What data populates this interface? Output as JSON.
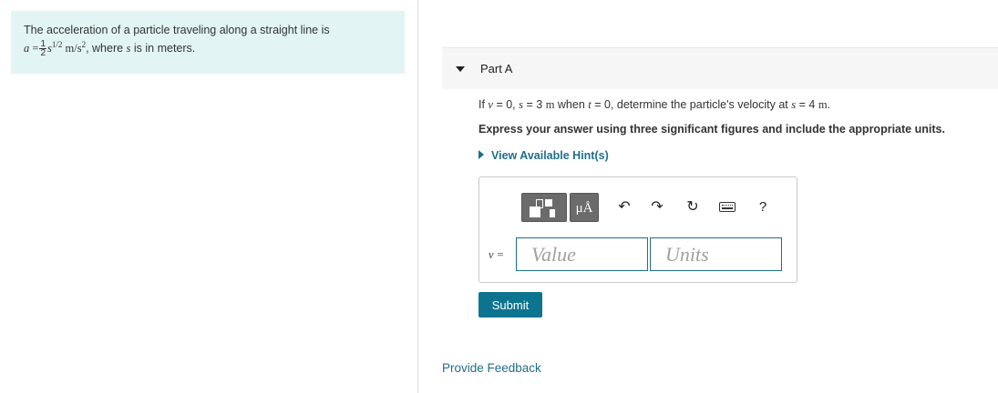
{
  "problem": {
    "line1": "The acceleration of a particle traveling along a straight line is",
    "eq_a": "a",
    "eq_equals": " =",
    "frac_num": "1",
    "frac_den": "2",
    "eq_s": "s",
    "eq_exp": "1/2",
    "eq_unit": " m/s",
    "eq_unit_exp": "2",
    "tail1": ", where ",
    "tail_s": "s",
    "tail2": " is in meters."
  },
  "part": {
    "caret_icon": "caret-down-icon",
    "title": "Part A",
    "q_prefix": "If ",
    "q_v": "v",
    "q_eq1": " = 0, ",
    "q_s": "s",
    "q_eq2": " = 3 ",
    "q_m": "m",
    "q_when": " when ",
    "q_t": "t",
    "q_eq3": " = 0, determine the particle's velocity at ",
    "q_s2": "s",
    "q_eq4": " = 4 ",
    "q_m2": "m",
    "q_end": ".",
    "instruction": "Express your answer using three significant figures and include the appropriate units.",
    "hint_label": "View Available Hint(s)"
  },
  "toolbar": {
    "templates_icon": "templates-icon",
    "units_label": "μÅ",
    "undo_glyph": "↶",
    "redo_glyph": "↷",
    "reset_glyph": "↻",
    "help_label": "?"
  },
  "answer": {
    "var_label": "v =",
    "value_placeholder": "Value",
    "value": "",
    "units_placeholder": "Units",
    "units": ""
  },
  "actions": {
    "submit_label": "Submit",
    "feedback_label": "Provide Feedback"
  },
  "colors": {
    "accent": "#1f6e8c",
    "submit_bg": "#0d7490",
    "problem_bg": "#e3f4f4",
    "toolbar_button": "#6b6b6b"
  }
}
